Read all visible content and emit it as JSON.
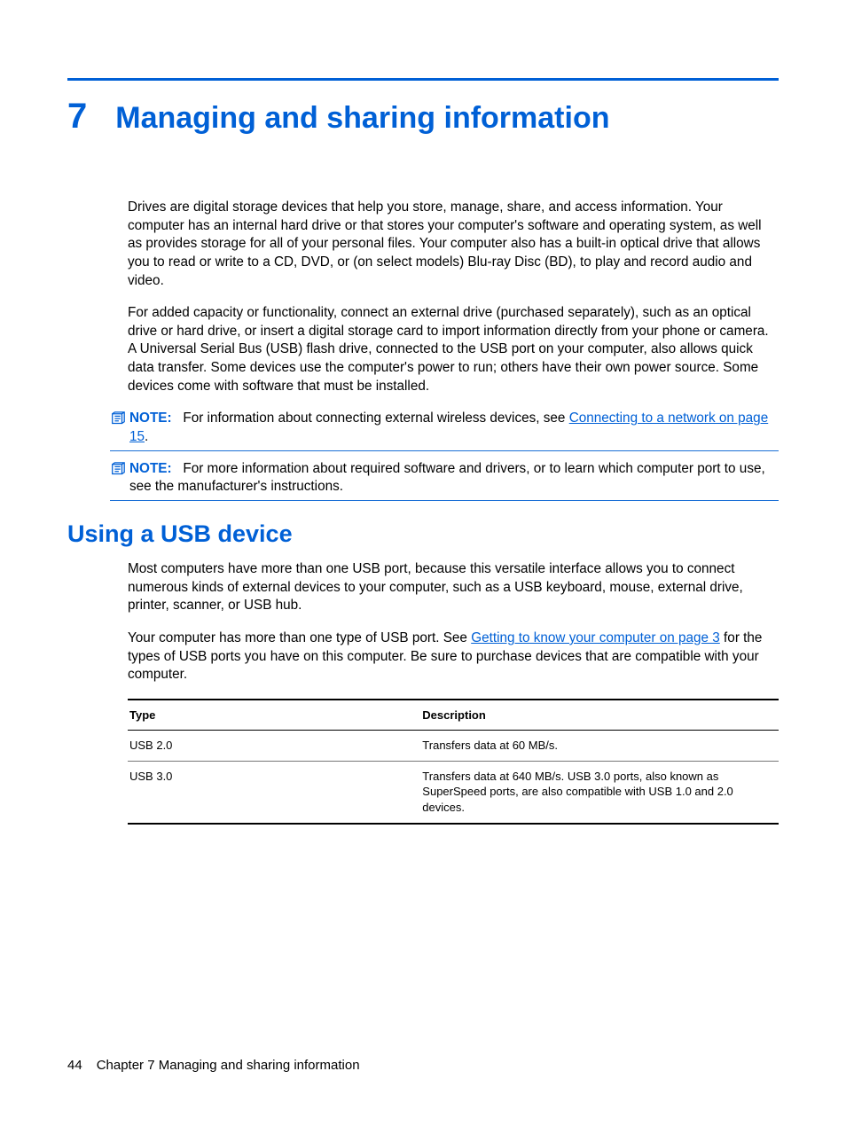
{
  "chapter": {
    "number": "7",
    "title": "Managing and sharing information"
  },
  "paragraphs": {
    "p1": "Drives are digital storage devices that help you store, manage, share, and access information. Your computer has an internal hard drive or that stores your computer's software and operating system, as well as provides storage for all of your personal files. Your computer also has a built-in optical drive that allows you to read or write to a CD, DVD, or (on select models) Blu-ray Disc (BD), to play and record audio and video.",
    "p2": "For added capacity or functionality, connect an external drive (purchased separately), such as an optical drive or hard drive, or insert a digital storage card to import information directly from your phone or camera. A Universal Serial Bus (USB) flash drive, connected to the USB port on your computer, also allows quick data transfer. Some devices use the computer's power to run; others have their own power source. Some devices come with software that must be installed."
  },
  "notes": {
    "label": "NOTE:",
    "n1_pre": "For information about connecting external wireless devices, see ",
    "n1_link": "Connecting to a network on page 15",
    "n1_post": ".",
    "n2": "For more information about required software and drivers, or to learn which computer port to use, see the manufacturer's instructions."
  },
  "section": {
    "heading": "Using a USB device",
    "p1": "Most computers have more than one USB port, because this versatile interface allows you to connect numerous kinds of external devices to your computer, such as a USB keyboard, mouse, external drive, printer, scanner, or USB hub.",
    "p2_pre": "Your computer has more than one type of USB port. See ",
    "p2_link": "Getting to know your computer on page 3",
    "p2_post": " for the types of USB ports you have on this computer. Be sure to purchase devices that are compatible with your computer."
  },
  "table": {
    "headers": {
      "type": "Type",
      "desc": "Description"
    },
    "rows": [
      {
        "type": "USB 2.0",
        "desc": "Transfers data at 60 MB/s."
      },
      {
        "type": "USB 3.0",
        "desc": "Transfers data at 640 MB/s. USB 3.0 ports, also known as SuperSpeed ports, are also compatible with USB 1.0 and 2.0 devices."
      }
    ]
  },
  "footer": {
    "page": "44",
    "text": "Chapter 7   Managing and sharing information"
  }
}
